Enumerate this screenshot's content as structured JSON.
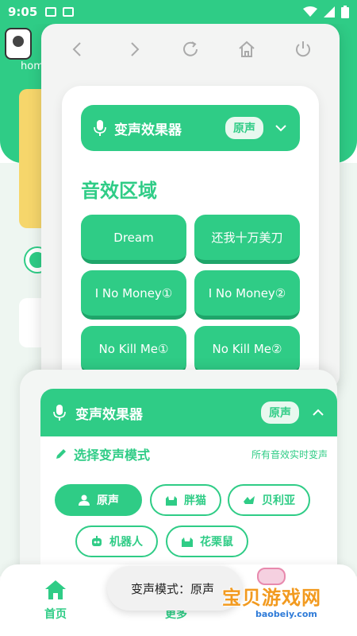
{
  "status_bar": {
    "time": "9:05"
  },
  "background_app": {
    "label": "hom"
  },
  "toolbar": {
    "back_icon": "chevron-left-icon",
    "forward_icon": "chevron-right-icon",
    "reload_icon": "reload-icon",
    "home_icon": "home-icon",
    "power_icon": "power-icon"
  },
  "effect_card": {
    "header_title": "变声效果器",
    "header_badge": "原声",
    "section_title": "音效区域",
    "effects": [
      "Dream",
      "还我十万美刀",
      "I No Money①",
      "I No Money②",
      "No Kill Me①",
      "No Kill Me②"
    ]
  },
  "changer_panel": {
    "header_title": "变声效果器",
    "header_badge": "原声",
    "mode_title": "选择变声模式",
    "mode_hint": "所有音效实时变声",
    "modes": [
      "原声",
      "胖猫",
      "贝利亚",
      "机器人",
      "花栗鼠"
    ]
  },
  "bottom_nav": {
    "home": "首页",
    "more": "更多"
  },
  "toast": {
    "text": "变声模式：原声"
  },
  "watermark": {
    "title": "宝贝游戏网",
    "url": "baobeiy.com"
  },
  "colors": {
    "accent": "#2fcc86",
    "accent_dark": "#1fa56a"
  }
}
